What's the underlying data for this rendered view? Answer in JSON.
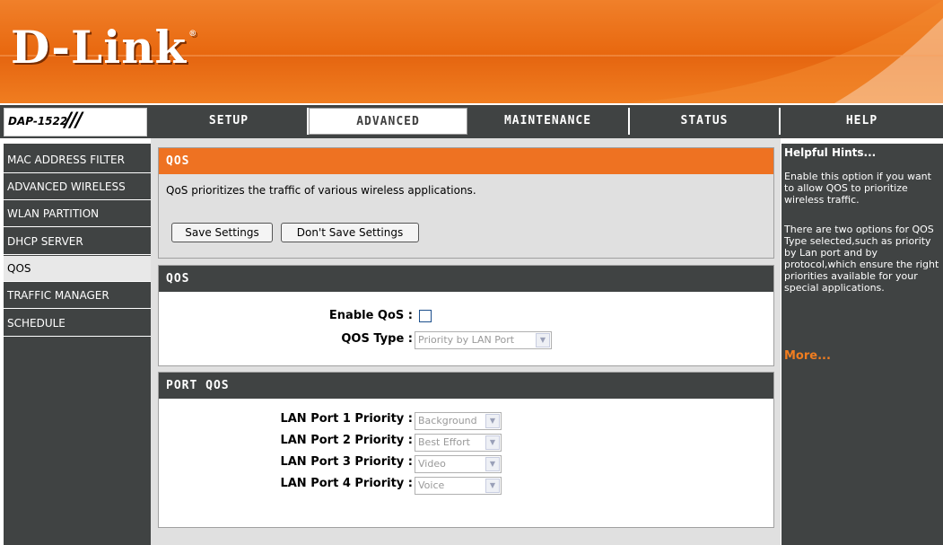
{
  "brand": {
    "logo_text": "D-Link",
    "registered": "®",
    "model": "DAP-1522",
    "model_slashes": "///"
  },
  "topnav": {
    "tabs": [
      {
        "label": "SETUP",
        "active": false
      },
      {
        "label": "ADVANCED",
        "active": true
      },
      {
        "label": "MAINTENANCE",
        "active": false
      },
      {
        "label": "STATUS",
        "active": false
      },
      {
        "label": "HELP",
        "active": false
      }
    ]
  },
  "sidebar": {
    "items": [
      {
        "label": "MAC ADDRESS FILTER",
        "active": false
      },
      {
        "label": "ADVANCED WIRELESS",
        "active": false
      },
      {
        "label": "WLAN PARTITION",
        "active": false
      },
      {
        "label": "DHCP SERVER",
        "active": false
      },
      {
        "label": "QOS",
        "active": true
      },
      {
        "label": "TRAFFIC MANAGER",
        "active": false
      },
      {
        "label": "SCHEDULE",
        "active": false
      }
    ]
  },
  "intro": {
    "title": "QOS",
    "description": "QoS prioritizes the traffic of various wireless applications.",
    "save_label": "Save Settings",
    "dont_save_label": "Don't Save Settings"
  },
  "qos": {
    "title": "QOS",
    "enable_label": "Enable QoS :",
    "enable_checked": false,
    "type_label": "QOS Type :",
    "type_value": "Priority by LAN Port"
  },
  "port_qos": {
    "title": "PORT QOS",
    "ports": [
      {
        "label": "LAN Port 1 Priority :",
        "value": "Background"
      },
      {
        "label": "LAN Port 2 Priority :",
        "value": "Best Effort"
      },
      {
        "label": "LAN Port 3 Priority :",
        "value": "Video"
      },
      {
        "label": "LAN Port 4 Priority :",
        "value": "Voice"
      }
    ]
  },
  "help": {
    "title": "Helpful Hints...",
    "para1": "Enable this option if you want to allow QOS to prioritize wireless traffic.",
    "para2": "There are two options for QOS Type selected,such as priority by Lan port and by protocol,which ensure the right priorities available for your special applications.",
    "more": "More..."
  },
  "colors": {
    "accent": "#e8670e",
    "nav_bg": "#404343",
    "panel_bg": "#e0e0e0"
  }
}
